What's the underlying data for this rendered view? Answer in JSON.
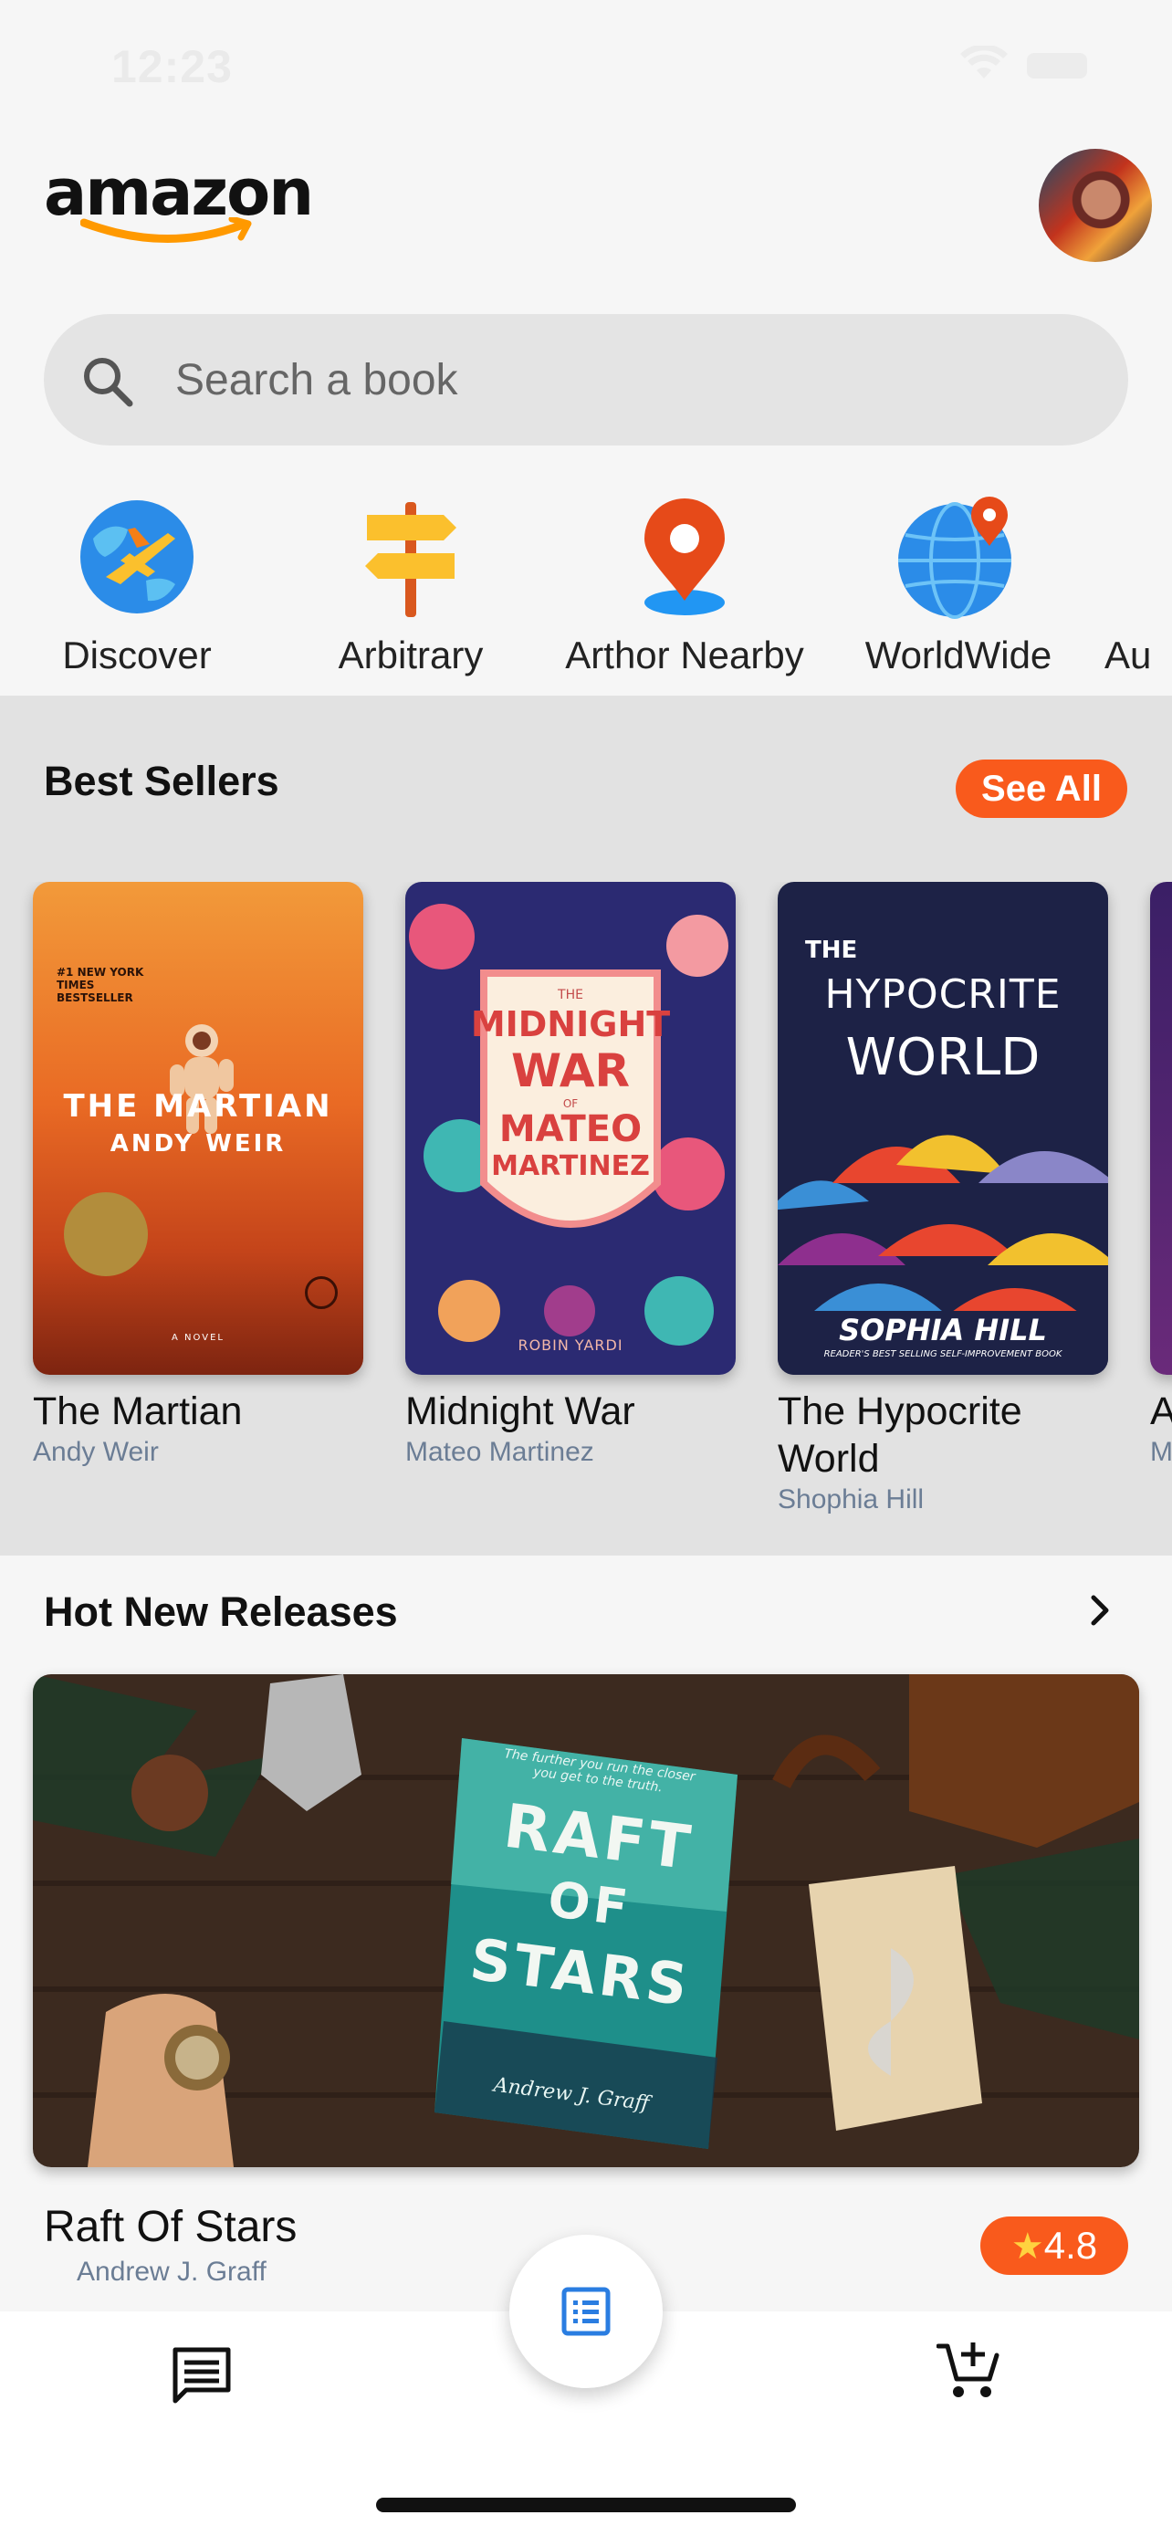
{
  "status_bar": {
    "time": "12:23",
    "wifi_icon": "wifi-icon",
    "battery_icon": "battery-icon"
  },
  "header": {
    "logo_text": "amazon",
    "logo_icon": "amazon-smile-icon",
    "avatar_icon": "avatar"
  },
  "search": {
    "placeholder": "Search a book",
    "icon": "search-icon"
  },
  "categories": [
    {
      "label": "Discover",
      "icon": "globe-plane-icon"
    },
    {
      "label": "Arbitrary",
      "icon": "signpost-icon"
    },
    {
      "label": "Arthor Nearby",
      "icon": "location-pin-icon"
    },
    {
      "label": "WorldWide",
      "icon": "globe-pin-icon"
    },
    {
      "label": "Au",
      "icon": "partial-category-icon"
    }
  ],
  "best_sellers": {
    "title": "Best Sellers",
    "see_all_label": "See All",
    "books": [
      {
        "title": "The Martian",
        "author": "Andy Weir",
        "cover_title": "THE MARTIAN",
        "cover_author": "ANDY WEIR",
        "cover_tag": "#1 NEW YORK TIMES BESTSELLER",
        "cover_footer": "A NOVEL"
      },
      {
        "title": "Midnight War",
        "author": "Mateo Martinez",
        "cover_line1": "THE",
        "cover_line2": "MIDNIGHT",
        "cover_line3": "WAR",
        "cover_line4": "OF",
        "cover_line5": "MATEO",
        "cover_line6": "MARTINEZ",
        "cover_footer": "ROBIN YARDI"
      },
      {
        "title": "The Hypocrite World",
        "author": "Shophia Hill",
        "cover_line1": "THE",
        "cover_line2": "HYPOCRITE",
        "cover_line3": "WORLD",
        "cover_author": "SOPHIA HILL",
        "cover_tagline": "READER'S BEST SELLING SELF-IMPROVEMENT BOOK"
      },
      {
        "title": "A",
        "author": "M"
      }
    ]
  },
  "hot_new_releases": {
    "title": "Hot New Releases",
    "chevron_icon": "chevron-right-icon",
    "banner_book": {
      "cover_tagline": "The further you run the closer you get to the truth.",
      "cover_line1": "RAFT",
      "cover_line2": "OF",
      "cover_line3": "STARS",
      "cover_author": "Andrew J. Graff"
    },
    "book_name": "Raft Of Stars",
    "book_author": "Andrew J. Graff",
    "rating": "4.8",
    "rating_icon": "star-icon"
  },
  "bottom_nav": {
    "messages_icon": "message-icon",
    "fab_icon": "list-icon",
    "cart_icon": "add-to-cart-icon"
  },
  "colors": {
    "accent": "#f95a1c",
    "background": "#f6f6f6",
    "section_bg": "#e2e2e2",
    "author_text": "#6b7d95",
    "fab_icon": "#2a7de1"
  }
}
